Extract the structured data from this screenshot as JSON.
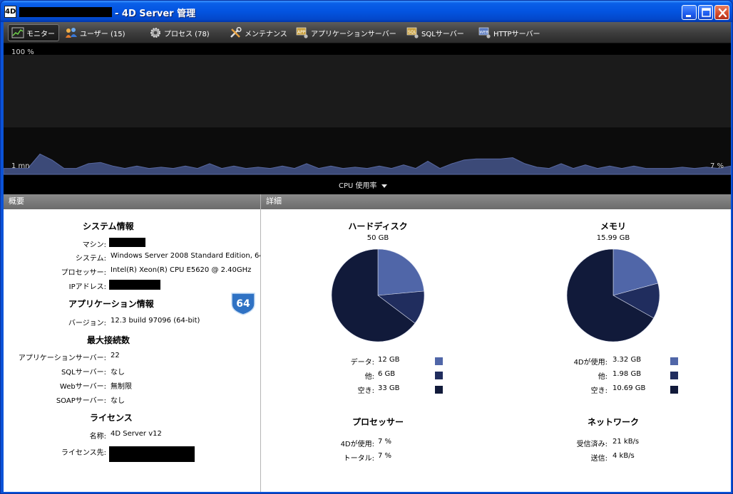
{
  "window": {
    "title": "- 4D Server 管理",
    "app_icon_text": "4D",
    "buttons": {
      "minimize": "minimize-icon",
      "maximize": "maximize-icon",
      "close": "close-icon"
    }
  },
  "toolbar": {
    "items": [
      {
        "label": "モニター",
        "icon": "monitor-icon"
      },
      {
        "label": "ユーザー (15)",
        "icon": "users-icon"
      },
      {
        "label": "プロセス (78)",
        "icon": "gear-icon"
      },
      {
        "label": "メンテナンス",
        "icon": "tools-icon"
      },
      {
        "label": "アプリケーションサーバー",
        "icon": "app-server-icon"
      },
      {
        "label": "SQLサーバー",
        "icon": "sql-server-icon"
      },
      {
        "label": "HTTPサーバー",
        "icon": "http-server-icon"
      }
    ]
  },
  "graph": {
    "top_label": "100 %",
    "bottom_left_label": "1 mn",
    "bottom_right_label": "7 %",
    "selector": "CPU 使用率",
    "cpu_values": [
      5,
      5,
      5,
      17,
      12,
      5,
      5,
      9,
      10,
      7,
      5,
      7,
      5,
      6,
      5,
      7,
      5,
      9,
      5,
      7,
      5,
      6,
      5,
      7,
      5,
      9,
      5,
      7,
      5,
      6,
      5,
      7,
      5,
      8,
      5,
      11,
      5,
      9,
      12,
      13,
      13,
      13,
      14,
      9,
      6,
      5,
      9,
      5,
      8,
      5,
      7,
      5,
      7,
      5,
      5,
      5,
      6,
      5,
      6,
      5,
      7
    ]
  },
  "overview": {
    "header": "概要",
    "system_info": {
      "title": "システム情報",
      "machine_label": "マシン:",
      "system_label": "システム:",
      "system_value": "Windows Server 2008 Standard Edition, 64-",
      "processor_label": "プロセッサー:",
      "processor_value": "Intel(R) Xeon(R) CPU E5620 @ 2.40GHz",
      "ip_label": "IPアドレス:"
    },
    "app_info": {
      "title": "アプリケーション情報",
      "version_label": "バージョン:",
      "version_value": "12.3 build 97096 (64-bit)",
      "badge": "64"
    },
    "max_connections": {
      "title": "最大接続数",
      "rows": [
        {
          "label": "アプリケーションサーバー:",
          "value": "22"
        },
        {
          "label": "SQLサーバー:",
          "value": "なし"
        },
        {
          "label": "Webサーバー:",
          "value": "無制限"
        },
        {
          "label": "SOAPサーバー:",
          "value": "なし"
        }
      ]
    },
    "license": {
      "title": "ライセンス",
      "name_label": "名称:",
      "name_value": "4D Server v12",
      "licensee_label": "ライセンス先:"
    }
  },
  "details": {
    "header": "詳細",
    "hard_disk": {
      "title": "ハードディスク",
      "total": "50 GB",
      "legend": [
        {
          "label": "データ:",
          "value": "12 GB",
          "amount": 12,
          "color": "#5066a8"
        },
        {
          "label": "他:",
          "value": "6 GB",
          "amount": 6,
          "color": "#202d5e"
        },
        {
          "label": "空き:",
          "value": "33 GB",
          "amount": 33,
          "color": "#111a3a"
        }
      ]
    },
    "memory": {
      "title": "メモリ",
      "total": "15.99 GB",
      "legend": [
        {
          "label": "4Dが使用:",
          "value": "3.32 GB",
          "amount": 3.32,
          "color": "#5066a8"
        },
        {
          "label": "他:",
          "value": "1.98 GB",
          "amount": 1.98,
          "color": "#202d5e"
        },
        {
          "label": "空き:",
          "value": "10.69 GB",
          "amount": 10.69,
          "color": "#111a3a"
        }
      ]
    },
    "processor": {
      "title": "プロセッサー",
      "rows": [
        {
          "label": "4Dが使用:",
          "value": "7 %"
        },
        {
          "label": "トータル:",
          "value": "7 %"
        }
      ]
    },
    "network": {
      "title": "ネットワーク",
      "rows": [
        {
          "label": "受信済み:",
          "value": "21 kB/s"
        },
        {
          "label": "送信:",
          "value": "4 kB/s"
        }
      ]
    }
  }
}
